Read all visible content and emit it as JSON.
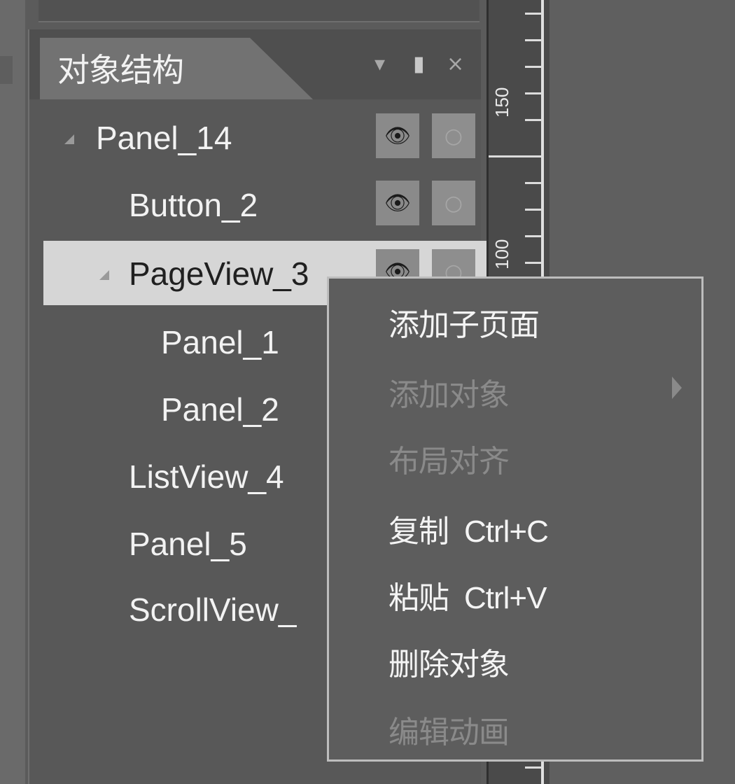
{
  "panel": {
    "title": "对象结构",
    "header_icons": {
      "dropdown": "▾",
      "pin": "▮",
      "close": "×"
    }
  },
  "tree": [
    {
      "label": "Panel_14"
    },
    {
      "label": "Button_2"
    },
    {
      "label": "PageView_3"
    },
    {
      "label": "Panel_1"
    },
    {
      "label": "Panel_2"
    },
    {
      "label": "ListView_4"
    },
    {
      "label": "Panel_5"
    },
    {
      "label": "ScrollView_"
    }
  ],
  "icons": {
    "eye": "👁",
    "lock": "○"
  },
  "ruler": {
    "labels": [
      "150",
      "100"
    ]
  },
  "context_menu": {
    "items": [
      {
        "label": "添加子页面",
        "shortcut": "",
        "enabled": true
      },
      {
        "label": "添加对象",
        "shortcut": "",
        "enabled": false,
        "has_submenu": true
      },
      {
        "label": "布局对齐",
        "shortcut": "",
        "enabled": false
      },
      {
        "label": "复制",
        "shortcut": "Ctrl+C",
        "enabled": true
      },
      {
        "label": "粘贴",
        "shortcut": "Ctrl+V",
        "enabled": true
      },
      {
        "label": "删除对象",
        "shortcut": "",
        "enabled": true
      },
      {
        "label": "编辑动画",
        "shortcut": "",
        "enabled": false
      }
    ]
  }
}
